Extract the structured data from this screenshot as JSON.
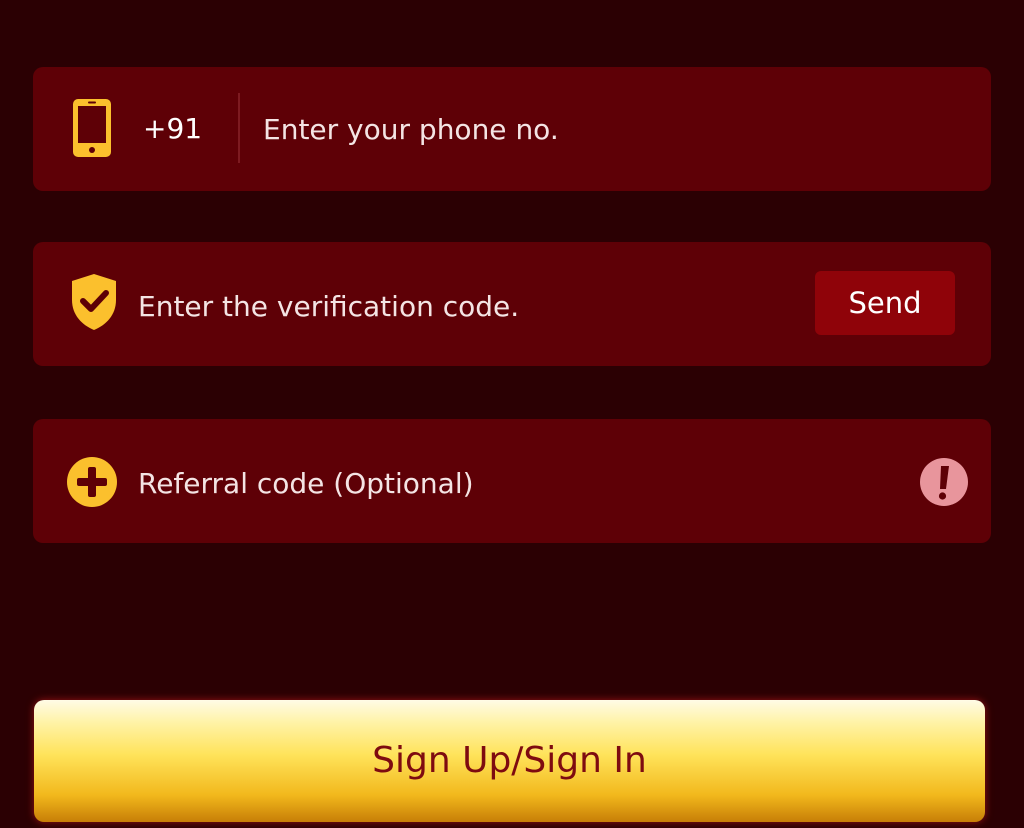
{
  "phone_row": {
    "country_code": "+91",
    "placeholder": "Enter your phone no.",
    "value": ""
  },
  "verification_row": {
    "placeholder": "Enter the verification code.",
    "value": "",
    "send_label": "Send"
  },
  "referral_row": {
    "placeholder": "Referral code (Optional)",
    "value": ""
  },
  "submit": {
    "label": "Sign Up/Sign In"
  },
  "icons": {
    "phone": "phone-icon",
    "verification": "shield-check-icon",
    "referral": "plus-circle-icon",
    "info": "exclamation-icon"
  },
  "colors": {
    "background": "#2b0003",
    "field_background": "#5e0006",
    "send_button": "#8f0309",
    "icon_gold": "#fbc02d",
    "info_pink": "#e8959c",
    "submit_text": "#7e0b10"
  }
}
